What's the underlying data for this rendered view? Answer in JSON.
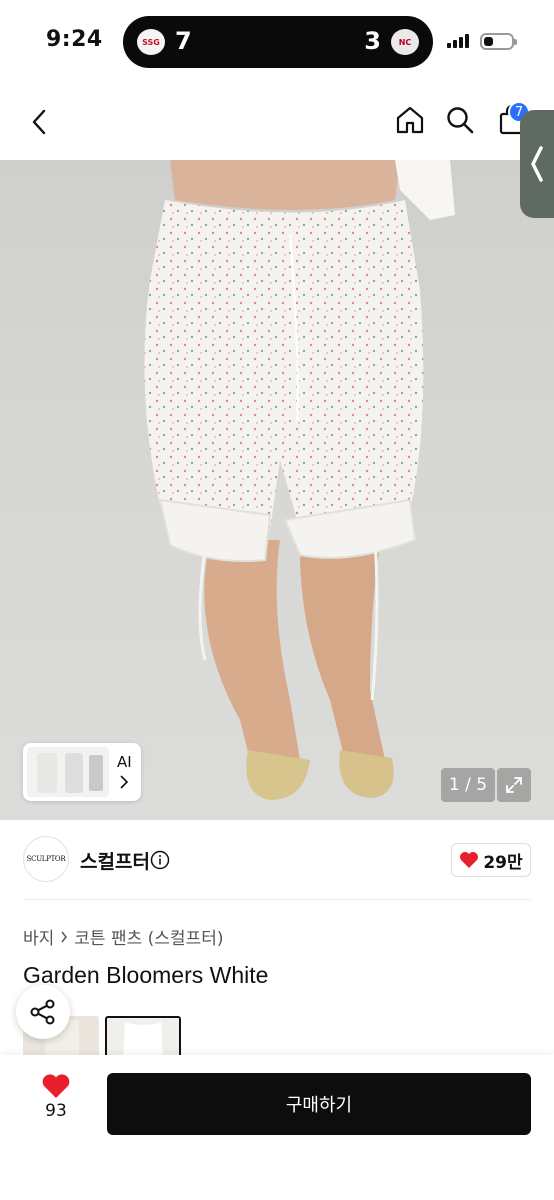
{
  "status_bar": {
    "time": "9:24",
    "live_activity": {
      "home_team_logo": "SSG",
      "home_score": "7",
      "away_score": "3",
      "away_team_logo": "NC"
    },
    "battery_level": 0.35
  },
  "nav": {
    "back_icon": "chevron-left-icon",
    "home_icon": "home-icon",
    "search_icon": "search-icon",
    "cart_icon": "bag-icon",
    "cart_badge": "7"
  },
  "gallery": {
    "ai_label": "AI",
    "page_indicator": "1 / 5",
    "expand_icon": "expand-icon"
  },
  "brand": {
    "logo_text": "SCULPTOR",
    "name": "스컬프터",
    "likes": "29만"
  },
  "product": {
    "breadcrumb": [
      "바지",
      "코튼 팬츠 (스컬프터)"
    ],
    "title": "Garden Bloomers White"
  },
  "bottom_bar": {
    "wish_count": "93",
    "buy_label": "구매하기"
  },
  "colors": {
    "accent_blue": "#2b6fff",
    "heart_red": "#e8202e",
    "buy_button": "#0d0d0d"
  }
}
